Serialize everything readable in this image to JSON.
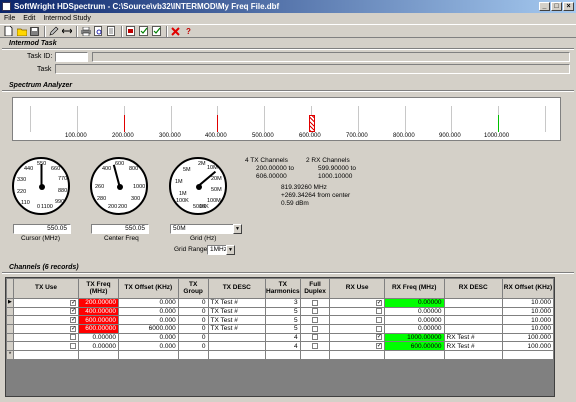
{
  "window": {
    "title": "SoftWright HDSpectrum - C:\\Source\\vb32\\INTERMOD\\My Freq File.dbf"
  },
  "menu": [
    "File",
    "Edit",
    "Intermod Study"
  ],
  "intermod_task": {
    "header": "Intermod Task",
    "task_id_label": "Task ID:",
    "task_id_value": "",
    "task_label": "Task",
    "task_value": ""
  },
  "spectrum": {
    "header": "Spectrum Analyzer",
    "tick_labels": [
      "100.000",
      "200.000",
      "300.000",
      "400.000",
      "500.000",
      "600.000",
      "700.000",
      "800.000",
      "900.000",
      "1000.000"
    ]
  },
  "dials": {
    "cursor": {
      "labels": [
        "550",
        "660",
        "440",
        "770",
        "330",
        "880",
        "220",
        "990",
        "110",
        "0",
        "1100"
      ],
      "value": "550.05",
      "caption": "Cursor (MHz)"
    },
    "center": {
      "labels": [
        "600",
        "400",
        "800",
        "260",
        "1000",
        "280",
        "300",
        "200",
        "200"
      ],
      "value": "550.05",
      "caption": "Center Freq"
    },
    "grid": {
      "labels": [
        "2M",
        "10M",
        "5M",
        "20M",
        "1M",
        "50M",
        "100M",
        "500K",
        "100K",
        "1M",
        "10K"
      ],
      "value": "50M",
      "caption": "Grid (Hz)",
      "range_label": "Grid Range",
      "range_value": "1MHz"
    }
  },
  "info": {
    "tx_channels": "4 TX Channels",
    "tx_range1": "200.00000 to",
    "tx_range2": "606.00000",
    "rx_channels": "2 RX Channels",
    "rx_range1": "599.90000 to",
    "rx_range2": "1000.10000",
    "cursor_freq": "819.39260 MHz",
    "cursor_offset": "+269.34264 from center",
    "cursor_level": "0.59 dBm"
  },
  "channels": {
    "header": "Channels (6 records)",
    "columns": [
      "TX Use",
      "TX Freq (MHz)",
      "TX Offset (KHz)",
      "TX Group",
      "TX DESC",
      "TX Harmonics",
      "Full Duplex",
      "RX Use",
      "RX Freq (MHz)",
      "RX DESC",
      "RX Offset (KHz)"
    ],
    "rows": [
      {
        "tx_use": true,
        "tx_freq": "200.00000",
        "tx_offset": "0.000",
        "tx_group": "0",
        "tx_desc": "TX Test #",
        "tx_harm": "3",
        "duplex": false,
        "rx_use": true,
        "rx_freq": "0.00000",
        "rx_desc": "",
        "rx_offset": "10.000",
        "current": true
      },
      {
        "tx_use": true,
        "tx_freq": "400.00000",
        "tx_offset": "0.000",
        "tx_group": "0",
        "tx_desc": "TX Test #",
        "tx_harm": "5",
        "duplex": false,
        "rx_use": false,
        "rx_freq": "0.00000",
        "rx_desc": "",
        "rx_offset": "10.000",
        "current": false
      },
      {
        "tx_use": true,
        "tx_freq": "600.00000",
        "tx_offset": "0.000",
        "tx_group": "0",
        "tx_desc": "TX Test #",
        "tx_harm": "5",
        "duplex": false,
        "rx_use": false,
        "rx_freq": "0.00000",
        "rx_desc": "",
        "rx_offset": "10.000",
        "current": false
      },
      {
        "tx_use": true,
        "tx_freq": "600.00000",
        "tx_offset": "6000.000",
        "tx_group": "0",
        "tx_desc": "TX Test #",
        "tx_harm": "5",
        "duplex": false,
        "rx_use": false,
        "rx_freq": "0.00000",
        "rx_desc": "",
        "rx_offset": "10.000",
        "current": false
      },
      {
        "tx_use": false,
        "tx_freq": "0.00000",
        "tx_offset": "0.000",
        "tx_group": "0",
        "tx_desc": "",
        "tx_harm": "4",
        "duplex": false,
        "rx_use": true,
        "rx_freq": "1000.00000",
        "rx_desc": "RX Test #",
        "rx_offset": "100.000",
        "current": false
      },
      {
        "tx_use": false,
        "tx_freq": "0.00000",
        "tx_offset": "0.000",
        "tx_group": "0",
        "tx_desc": "",
        "tx_harm": "4",
        "duplex": false,
        "rx_use": true,
        "rx_freq": "600.00000",
        "rx_desc": "RX Test #",
        "rx_offset": "100.000",
        "current": false
      }
    ]
  },
  "colors": {
    "tx_freq_bg": "#ff0000",
    "rx_freq_bg": "#00ff00",
    "title_start": "#0a246a",
    "title_end": "#a6caf0"
  }
}
